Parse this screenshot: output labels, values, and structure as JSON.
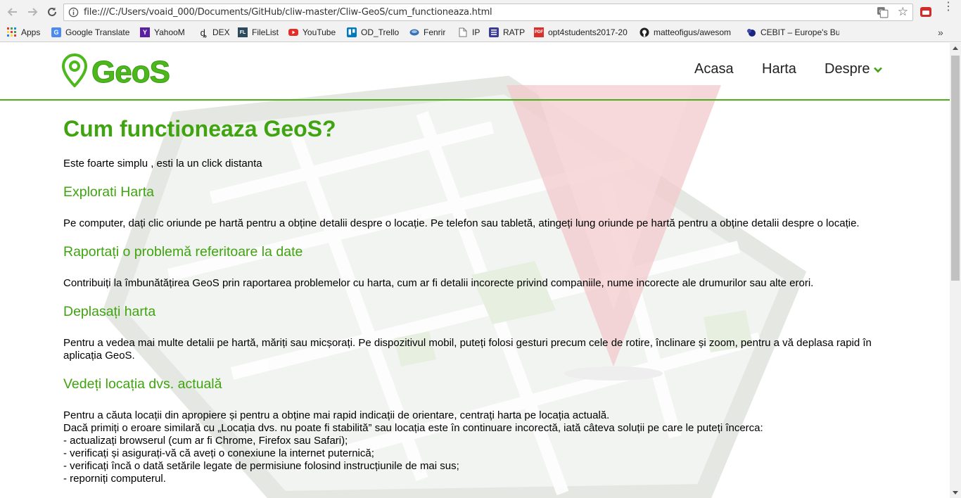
{
  "browser": {
    "url": "file:///C:/Users/voaid_000/Documents/GitHub/cliw-master/Cliw-GeoS/cum_functioneaza.html",
    "bookmarks": [
      {
        "label": "Apps",
        "icon": "apps-grid-icon"
      },
      {
        "label": "Google Translate",
        "icon": "google-translate-icon"
      },
      {
        "label": "YahooM",
        "icon": "yahoo-icon"
      },
      {
        "label": "DEX",
        "icon": "dex-icon"
      },
      {
        "label": "FileList",
        "icon": "filelist-icon"
      },
      {
        "label": "YouTube",
        "icon": "youtube-icon"
      },
      {
        "label": "OD_Trello",
        "icon": "trello-icon"
      },
      {
        "label": "Fenrir",
        "icon": "fenrir-icon"
      },
      {
        "label": "IP",
        "icon": "page-icon"
      },
      {
        "label": "RATP",
        "icon": "ratp-icon"
      },
      {
        "label": "opt4students2017-20",
        "icon": "pdf-icon"
      },
      {
        "label": "matteofigus/awesom",
        "icon": "github-icon"
      },
      {
        "label": "CEBIT – Europe's Busi",
        "icon": "cebit-icon"
      }
    ]
  },
  "site": {
    "logo_text": "GeoS",
    "nav": {
      "home": "Acasa",
      "map": "Harta",
      "about": "Despre"
    },
    "accent_color": "#3fa40f"
  },
  "content": {
    "title": "Cum functioneaza GeoS?",
    "intro": "Este foarte simplu , esti la un click distanta",
    "sections": [
      {
        "heading": "Explorati Harta",
        "text": "Pe computer, dați clic oriunde pe hartă pentru a obține detalii despre o locație. Pe telefon sau tabletă, atingeți lung oriunde pe hartă pentru a obține detalii despre o locație."
      },
      {
        "heading": "Raportați o problemă referitoare la date",
        "text": "Contribuiți la îmbunătățirea GeoS prin raportarea problemelor cu harta, cum ar fi detalii incorecte privind companiile, nume incorecte ale drumurilor sau alte erori."
      },
      {
        "heading": "Deplasați harta",
        "text": "Pentru a vedea mai multe detalii pe hartă, măriți sau micșorați. Pe dispozitivul mobil, puteți folosi gesturi precum cele de rotire, înclinare și zoom, pentru a vă deplasa rapid în aplicația GeoS."
      },
      {
        "heading": "Vedeți locația dvs. actuală",
        "lines": [
          "Pentru a căuta locații din apropiere și pentru a obține mai rapid indicații de orientare, centrați harta pe locația actuală.",
          "Dacă primiți o eroare similară cu „Locația dvs. nu poate fi stabilită” sau locația este în continuare incorectă, iată câteva soluții pe care le puteți încerca:",
          "- actualizați browserul (cum ar fi Chrome, Firefox sau Safari);",
          "- verificați și asigurați-vă că aveți o conexiune la internet puternică;",
          "- verificați încă o dată setările legate de permisiune folosind instrucțiunile de mai sus;",
          "- reporniți computerul."
        ]
      }
    ]
  }
}
